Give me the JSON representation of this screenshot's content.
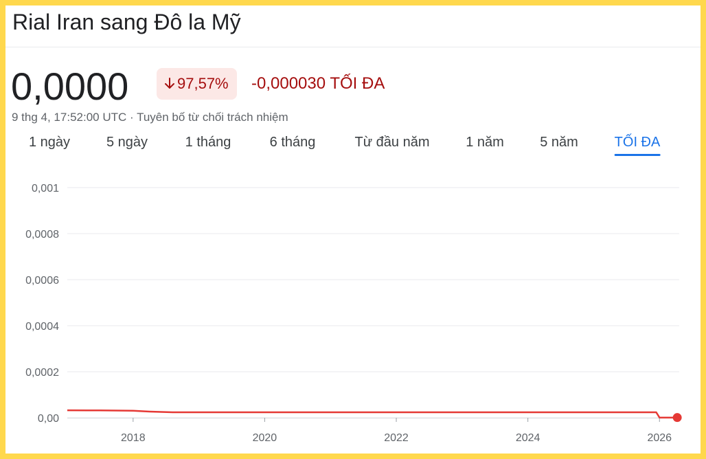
{
  "header": {
    "title": "Rial Iran sang Đô la Mỹ",
    "price": "0,0000",
    "change_percent": "97,57%",
    "change_value": "-0,000030 TỐI ĐA",
    "timestamp": "9 thg 4, 17:52:00 UTC",
    "separator": " · ",
    "disclaimer": "Tuyên bố từ chối trách nhiệm"
  },
  "colors": {
    "negative": "#a50e0e",
    "line": "#e53935",
    "accent": "#1a73e8"
  },
  "tabs": [
    {
      "label": "1 ngày",
      "active": false
    },
    {
      "label": "5 ngày",
      "active": false
    },
    {
      "label": "1 tháng",
      "active": false
    },
    {
      "label": "6 tháng",
      "active": false
    },
    {
      "label": "Từ đầu năm",
      "active": false
    },
    {
      "label": "1 năm",
      "active": false
    },
    {
      "label": "5 năm",
      "active": false
    },
    {
      "label": "TỐI ĐA",
      "active": true
    }
  ],
  "chart_data": {
    "type": "line",
    "title": "",
    "xlabel": "",
    "ylabel": "",
    "ylim": [
      0,
      0.001
    ],
    "xlim": [
      2017.0,
      2026.3
    ],
    "grid": true,
    "y_ticks": [
      {
        "value": 0.001,
        "label": "0,001"
      },
      {
        "value": 0.0008,
        "label": "0,0008"
      },
      {
        "value": 0.0006,
        "label": "0,0006"
      },
      {
        "value": 0.0004,
        "label": "0,0004"
      },
      {
        "value": 0.0002,
        "label": "0,0002"
      },
      {
        "value": 0,
        "label": "0,00"
      }
    ],
    "x_ticks": [
      {
        "value": 2018,
        "label": "2018"
      },
      {
        "value": 2020,
        "label": "2020"
      },
      {
        "value": 2022,
        "label": "2022"
      },
      {
        "value": 2024,
        "label": "2024"
      },
      {
        "value": 2026,
        "label": "2026"
      }
    ],
    "series": [
      {
        "x": [
          2017.0,
          2017.5,
          2018.0,
          2018.25,
          2018.6,
          2019.0,
          2020.0,
          2021.0,
          2022.0,
          2023.0,
          2024.0,
          2025.0,
          2025.95,
          2026.0,
          2026.15,
          2026.27
        ],
        "values": [
          3.25e-05,
          3.2e-05,
          3.05e-05,
          2.7e-05,
          2.4e-05,
          2.4e-05,
          2.38e-05,
          2.38e-05,
          2.38e-05,
          2.38e-05,
          2.38e-05,
          2.38e-05,
          2.38e-05,
          1e-06,
          1e-06,
          1e-06
        ]
      }
    ]
  }
}
